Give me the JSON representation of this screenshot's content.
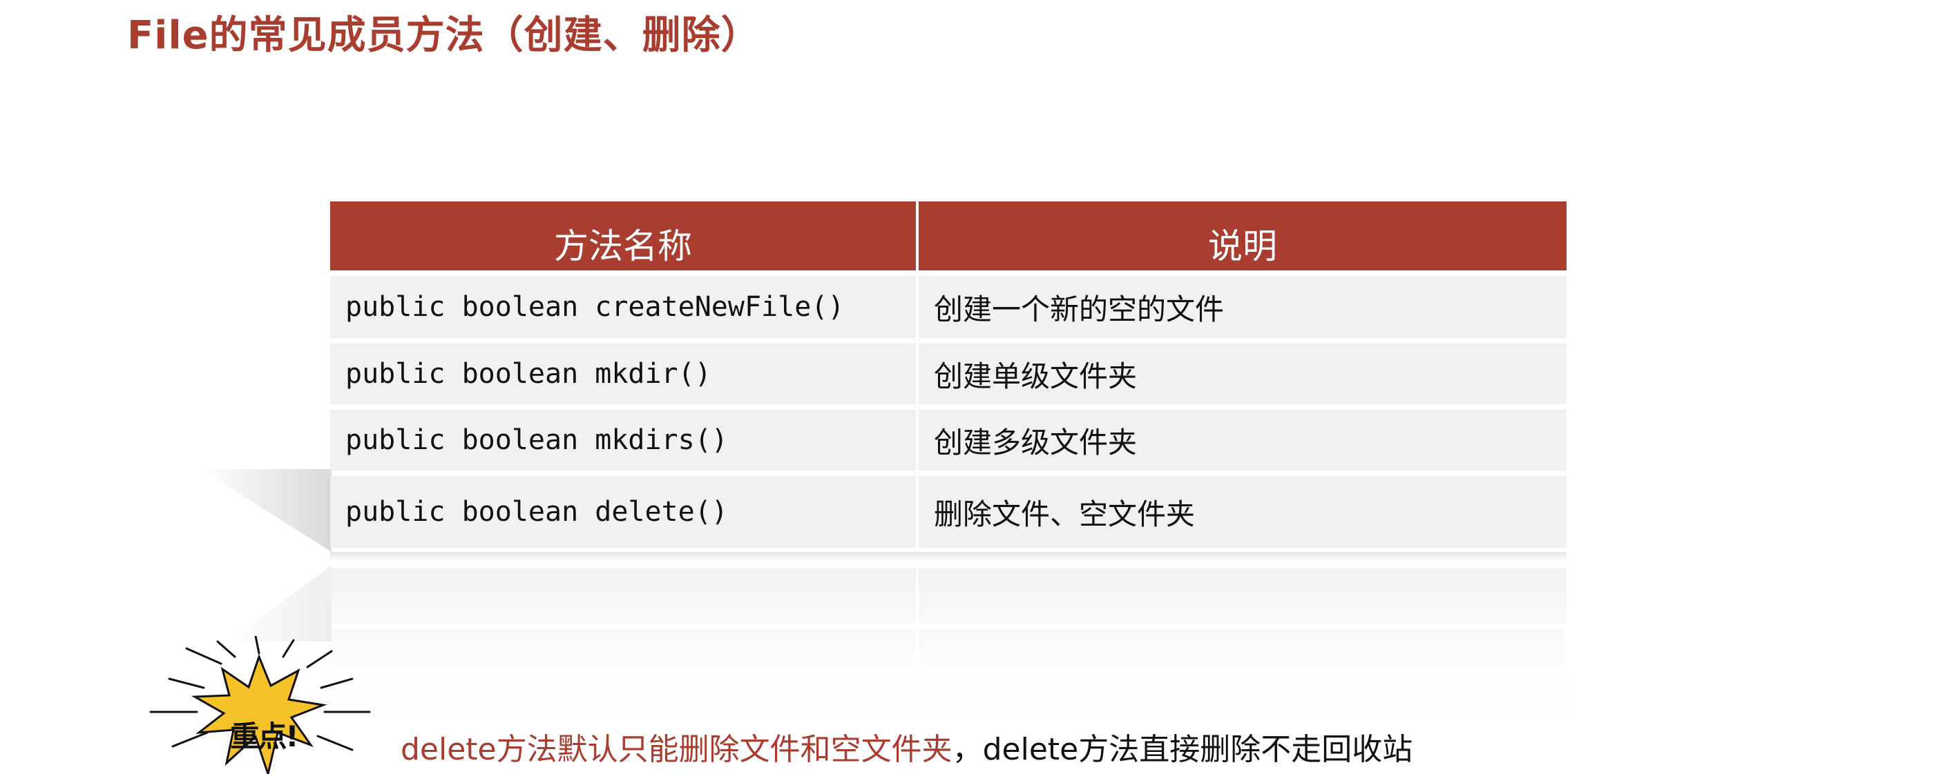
{
  "title": "File的常见成员方法（创建、删除）",
  "table": {
    "headers": [
      "方法名称",
      "说明"
    ],
    "rows": [
      {
        "method": "public boolean createNewFile()",
        "desc": "创建一个新的空的文件"
      },
      {
        "method": "public boolean mkdir()",
        "desc": "创建单级文件夹"
      },
      {
        "method": "public boolean mkdirs()",
        "desc": "创建多级文件夹"
      },
      {
        "method": "public boolean delete()",
        "desc": "删除文件、空文件夹"
      }
    ]
  },
  "badge": {
    "label": "重点!"
  },
  "note": {
    "highlight": "delete方法默认只能删除文件和空文件夹",
    "separator": "，",
    "rest": "delete方法直接删除不走回收站"
  },
  "colors": {
    "accent": "#a93d2f",
    "cell_bg": "#f1f1f1",
    "badge_fill": "#f5c22a"
  }
}
